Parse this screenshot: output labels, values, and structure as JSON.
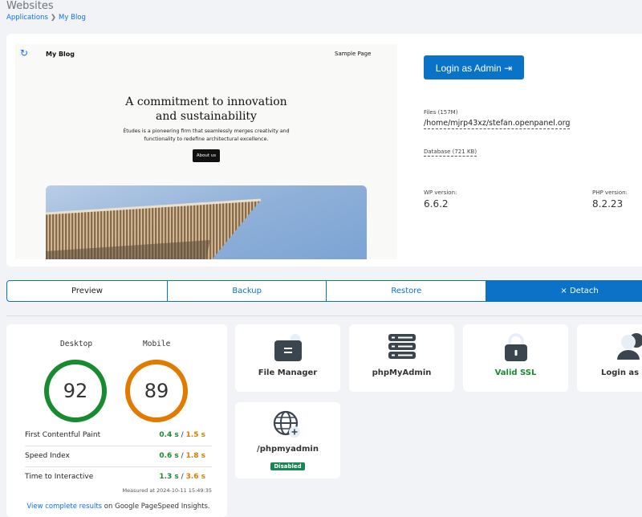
{
  "header": {
    "title": "Websites",
    "breadcrumb": [
      {
        "label": "Applications"
      },
      {
        "label": "My Blog"
      }
    ],
    "breadcrumb_sep": "❯"
  },
  "preview": {
    "site_title": "My Blog",
    "nav_link": "Sample Page",
    "hero_title_line1": "A commitment to innovation",
    "hero_title_line2": "and sustainability",
    "hero_text": "Études is a pioneering firm that seamlessly merges creativity and functionality to redefine architectural excellence.",
    "cta": "About us"
  },
  "site_info": {
    "admin_button": "Login as Admin",
    "files_label": "Files (157M)",
    "files_path": "/home/mjrp43xz/stefan.openpanel.org",
    "database_label": "Database (721 KB)",
    "wp_label": "WP version:",
    "wp_value": "6.6.2",
    "php_label": "PHP version:",
    "php_value": "8.2.23"
  },
  "tabs": [
    {
      "label": "Preview",
      "active": true
    },
    {
      "label": "Backup"
    },
    {
      "label": "Restore"
    },
    {
      "label": "× Detach"
    }
  ],
  "pagespeed": {
    "desktop_label": "Desktop",
    "desktop_score": "92",
    "mobile_label": "Mobile",
    "mobile_score": "89",
    "metrics": [
      {
        "name": "First Contentful Paint",
        "desktop": "0.4 s",
        "mobile": "1.5 s"
      },
      {
        "name": "Speed Index",
        "desktop": "0.6 s",
        "mobile": "1.8 s"
      },
      {
        "name": "Time to Interactive",
        "desktop": "1.3 s",
        "mobile": "3.6 s"
      }
    ],
    "measured": "Measured at 2024-10-11 15:49:35",
    "link_text": "View complete results",
    "link_suffix": " on Google PageSpeed Insights."
  },
  "tools": {
    "file_manager": "File Manager",
    "phpmyadmin": "phpMyAdmin",
    "ssl": "Valid SSL",
    "login_admin": "Login as admin",
    "phpmyadmin_path": "/phpmyadmin",
    "phpmyadmin_status": "Disabled"
  },
  "colors": {
    "primary": "#0a73c8",
    "good": "#188a2f",
    "average": "#e07b00"
  }
}
